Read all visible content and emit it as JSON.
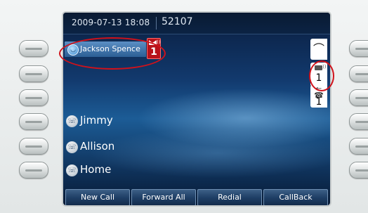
{
  "header": {
    "datetime": "2009-07-13 18:08",
    "extension": "52107"
  },
  "line": {
    "label": "Jackson Spence",
    "message_count": "1"
  },
  "speed_dials": [
    {
      "label": "Jimmy"
    },
    {
      "label": "Allison"
    },
    {
      "label": "Home"
    }
  ],
  "indicators": {
    "voicemail_count": "1",
    "missed_count": "1"
  },
  "softkeys": [
    {
      "label": "New Call"
    },
    {
      "label": "Forward All"
    },
    {
      "label": "Redial"
    },
    {
      "label": "CallBack"
    }
  ],
  "colors": {
    "accent_red": "#d0121b",
    "screen_blue": "#1c5c96"
  },
  "icons": {
    "line_status": "line-status-icon",
    "speed_dial": "speed-dial-icon",
    "handset": "handset-icon",
    "voicemail": "voicemail-icon",
    "missed_call": "missed-call-icon"
  }
}
